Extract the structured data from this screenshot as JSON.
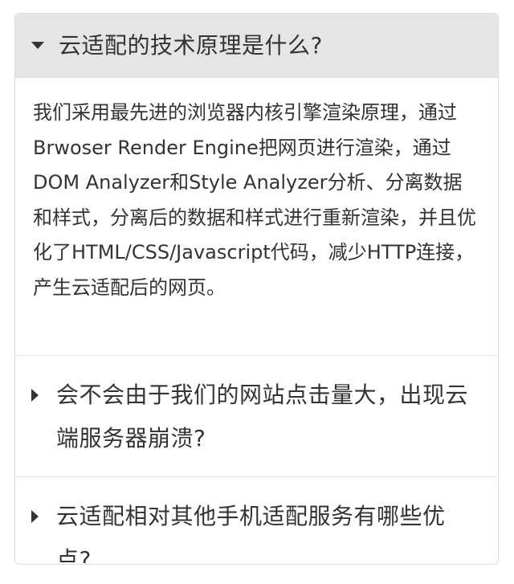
{
  "faq": {
    "items": [
      {
        "question": "云适配的技术原理是什么?",
        "expanded": true,
        "answer": "我们采用最先进的浏览器内核引擎渲染原理，通过Brwoser Render Engine把网页进行渲染，通过DOM Analyzer和Style Analyzer分析、分离数据和样式，分离后的数据和样式进行重新渲染，并且优化了HTML/CSS/Javascript代码，减少HTTP连接，产生云适配后的网页。"
      },
      {
        "question": "会不会由于我们的网站点击量大，出现云端服务器崩溃?",
        "expanded": false
      },
      {
        "question": "云适配相对其他手机适配服务有哪些优点?",
        "expanded": false
      }
    ],
    "icons": {
      "expanded": "caret-down-icon",
      "collapsed": "caret-right-icon"
    },
    "colors": {
      "open_header_bg": "#e5e5e5",
      "border": "#dddddd",
      "text": "#333333"
    }
  }
}
